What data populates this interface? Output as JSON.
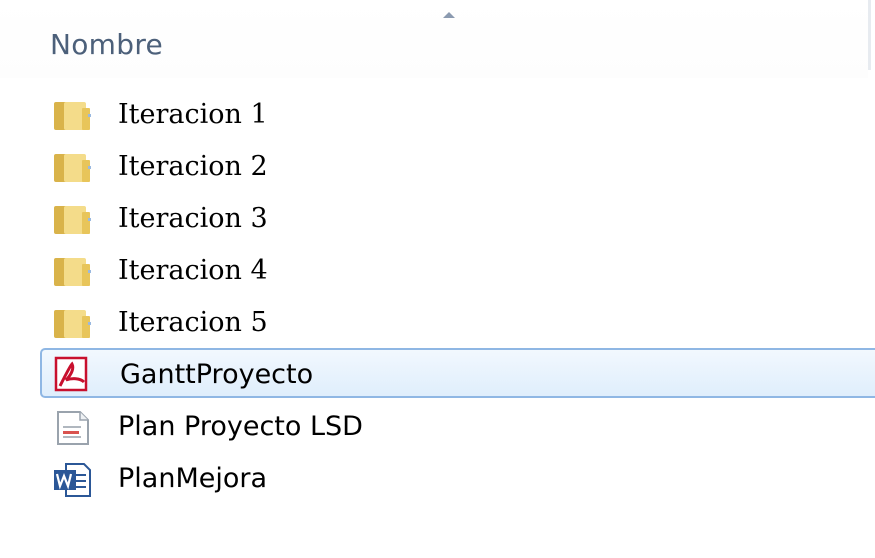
{
  "header": {
    "column_label": "Nombre",
    "sort_icon": "sort-ascending-icon"
  },
  "items": [
    {
      "label": "Iteracion 1",
      "icon": "folder-icon",
      "selected": false
    },
    {
      "label": "Iteracion 2",
      "icon": "folder-icon",
      "selected": false
    },
    {
      "label": "Iteracion 3",
      "icon": "folder-icon",
      "selected": false
    },
    {
      "label": "Iteracion 4",
      "icon": "folder-icon",
      "selected": false
    },
    {
      "label": "Iteracion 5",
      "icon": "folder-icon",
      "selected": false
    },
    {
      "label": "GanttProyecto",
      "icon": "pdf-file-icon",
      "selected": true
    },
    {
      "label": "Plan Proyecto LSD",
      "icon": "document-file-icon",
      "selected": false
    },
    {
      "label": "PlanMejora",
      "icon": "word-document-icon",
      "selected": false
    }
  ],
  "colors": {
    "header_text": "#4c607a",
    "selection_border": "#8fb7e4",
    "selection_fill": "#dfeefc",
    "folder": "#e8c55a",
    "pdf_red": "#c8102e",
    "word_blue": "#2b5797"
  }
}
